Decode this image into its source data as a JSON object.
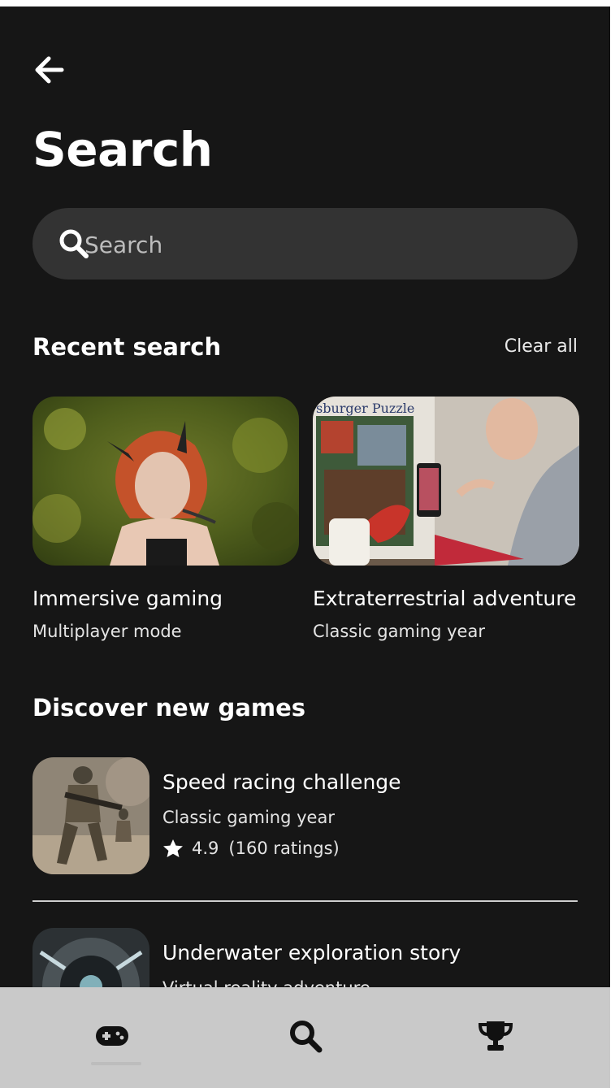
{
  "page": {
    "title": "Search"
  },
  "search": {
    "placeholder": "Search"
  },
  "recent": {
    "heading": "Recent search",
    "clear_label": "Clear all",
    "items": [
      {
        "name": "Immersive gaming",
        "subtitle": "Multiplayer mode",
        "image": "cosplay-portrait-photo"
      },
      {
        "name": "Extraterrestrial adventure",
        "subtitle": "Classic gaming year",
        "image": "puzzle-table-photo",
        "image_text": "sburger Puzzle"
      }
    ]
  },
  "discover": {
    "heading": "Discover new games",
    "items": [
      {
        "name": "Speed racing challenge",
        "subtitle": "Classic gaming year",
        "rating": "4.9",
        "ratings_count": "(160 ratings)",
        "image": "soldier-battle-art"
      },
      {
        "name": "Underwater exploration story",
        "subtitle": "Virtual reality adventure",
        "image": "spaceship-corridor-art"
      }
    ]
  },
  "nav": {
    "tabs": [
      {
        "icon": "gamepad-icon",
        "active": true
      },
      {
        "icon": "search-icon",
        "active": false
      },
      {
        "icon": "trophy-icon",
        "active": false
      }
    ]
  },
  "colors": {
    "background": "#161616",
    "search_field": "#333333",
    "nav_bar": "#c9c9c9",
    "text": "#ffffff"
  }
}
